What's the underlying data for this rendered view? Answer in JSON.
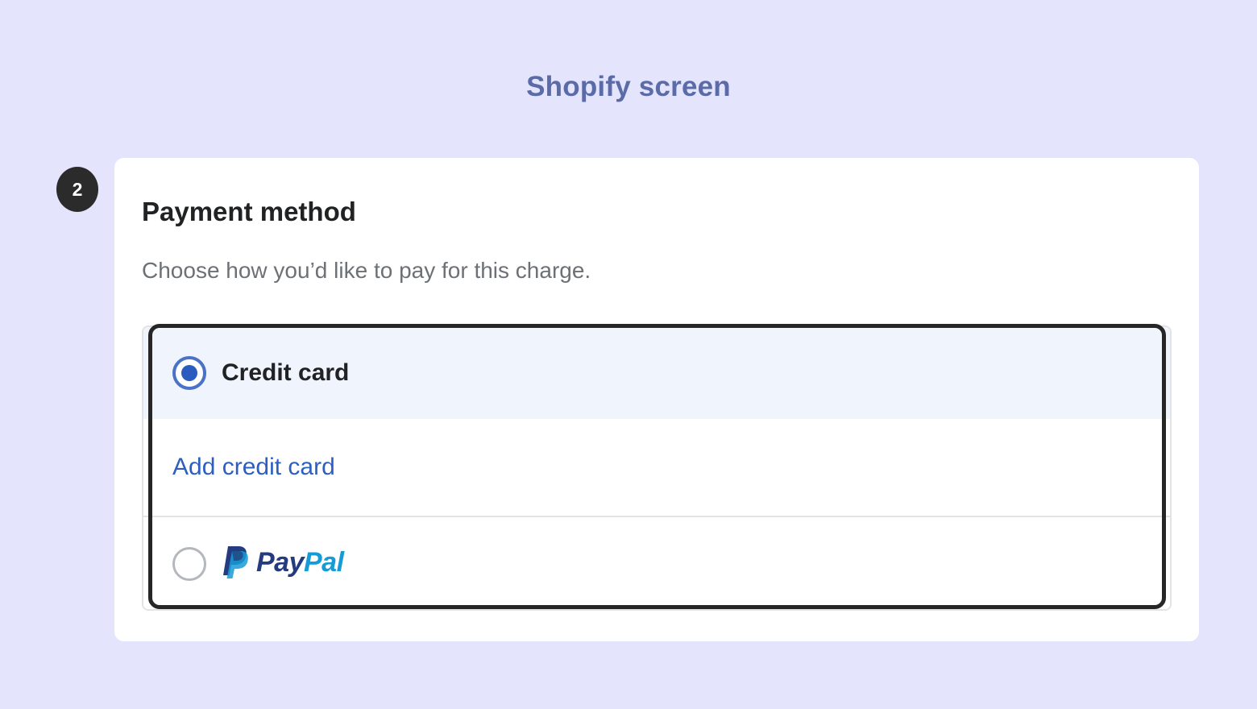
{
  "header": {
    "title": "Shopify screen"
  },
  "step": {
    "number": "2"
  },
  "payment": {
    "title": "Payment method",
    "subtitle": "Choose how you’d like to pay for this charge.",
    "options": [
      {
        "label": "Credit card",
        "selected": true
      },
      {
        "label": "PayPal",
        "selected": false
      }
    ],
    "add_card_label": "Add credit card",
    "paypal_logo": {
      "pay": "Pay",
      "pal": "Pal"
    }
  },
  "colors": {
    "background": "#e4e4fd",
    "title": "#5a6ba8",
    "accent": "#2c5fc0",
    "selected_row": "#f0f4fd",
    "paypal_dark": "#253b80",
    "paypal_light": "#179bd7"
  }
}
